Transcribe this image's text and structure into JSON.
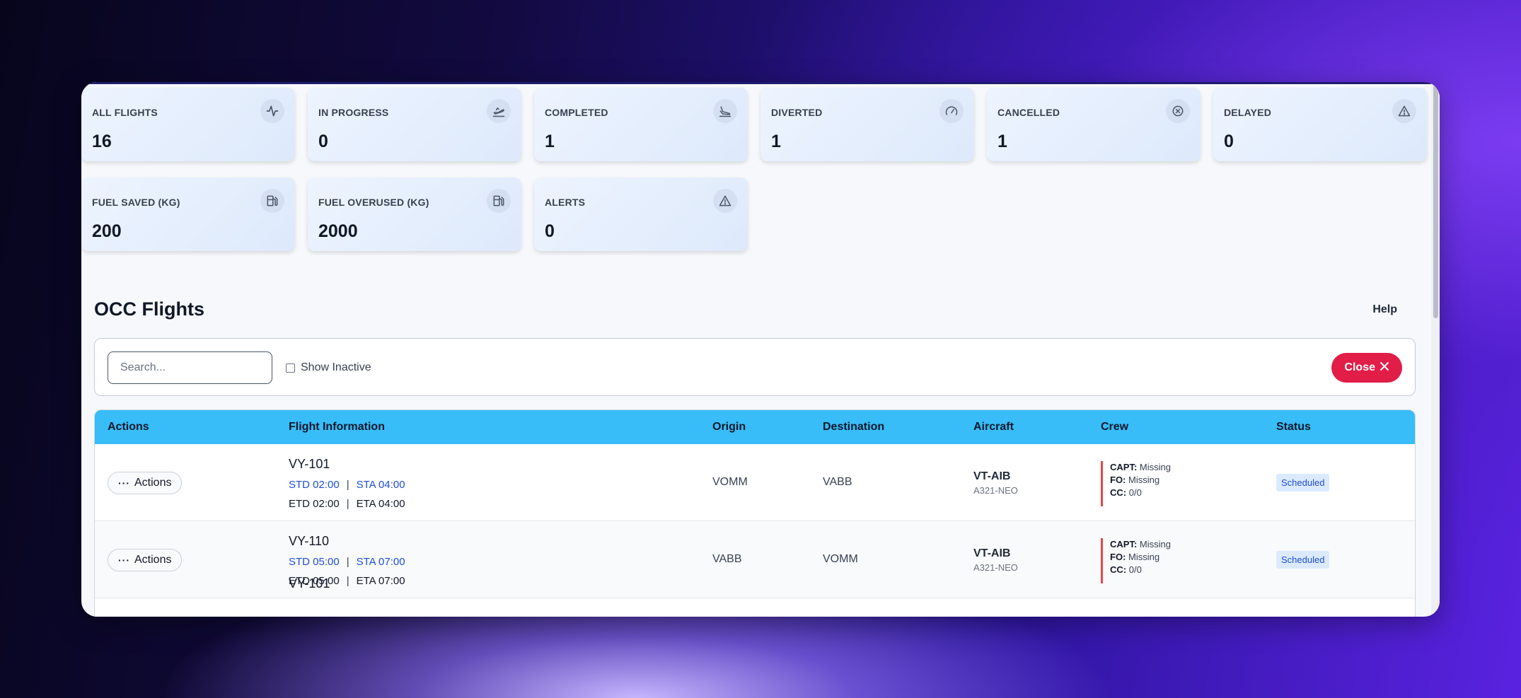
{
  "stats": [
    {
      "label": "ALL FLIGHTS",
      "value": "16",
      "icon": "activity-icon"
    },
    {
      "label": "IN PROGRESS",
      "value": "0",
      "icon": "plane-takeoff-icon"
    },
    {
      "label": "COMPLETED",
      "value": "1",
      "icon": "plane-landing-icon"
    },
    {
      "label": "DIVERTED",
      "value": "1",
      "icon": "gauge-icon"
    },
    {
      "label": "CANCELLED",
      "value": "1",
      "icon": "x-circle-icon"
    },
    {
      "label": "DELAYED",
      "value": "0",
      "icon": "warning-icon"
    },
    {
      "label": "FUEL SAVED (KG)",
      "value": "200",
      "icon": "fuel-icon"
    },
    {
      "label": "FUEL OVERUSED (KG)",
      "value": "2000",
      "icon": "fuel-icon"
    },
    {
      "label": "ALERTS",
      "value": "0",
      "icon": "warning-icon"
    }
  ],
  "page": {
    "title": "OCC Flights",
    "help_label": "Help"
  },
  "toolbar": {
    "search_placeholder": "Search...",
    "show_inactive_label": "Show Inactive",
    "close_label": "Close"
  },
  "table": {
    "headers": [
      "Actions",
      "Flight Information",
      "Origin",
      "Destination",
      "Aircraft",
      "Crew",
      "Status"
    ],
    "rows": [
      {
        "actions_label": "Actions",
        "flight": "VY-101",
        "std": "STD 02:00",
        "sta": "STA 04:00",
        "etd": "ETD 02:00",
        "eta": "ETA 04:00",
        "origin": "VOMM",
        "destination": "VABB",
        "aircraft_reg": "VT-AIB",
        "aircraft_type": "A321-NEO",
        "capt_label": "CAPT:",
        "capt": "Missing",
        "fo_label": "FO:",
        "fo": "Missing",
        "cc_label": "CC:",
        "cc": "0/0",
        "status": "Scheduled"
      },
      {
        "actions_label": "Actions",
        "flight": "VY-110",
        "std": "STD 05:00",
        "sta": "STA 07:00",
        "etd": "ETD 05:00",
        "eta": "ETA 07:00",
        "origin": "VABB",
        "destination": "VOMM",
        "aircraft_reg": "VT-AIB",
        "aircraft_type": "A321-NEO",
        "capt_label": "CAPT:",
        "capt": "Missing",
        "fo_label": "FO:",
        "fo": "Missing",
        "cc_label": "CC:",
        "cc": "0/0",
        "status": "Scheduled"
      }
    ],
    "peek_flight": "VY-101"
  },
  "colors": {
    "header": "#38bdf8",
    "close": "#e11d48",
    "status_bg": "#dbeafe",
    "status_fg": "#1d4ed8",
    "crew_bar": "#ef4444"
  }
}
